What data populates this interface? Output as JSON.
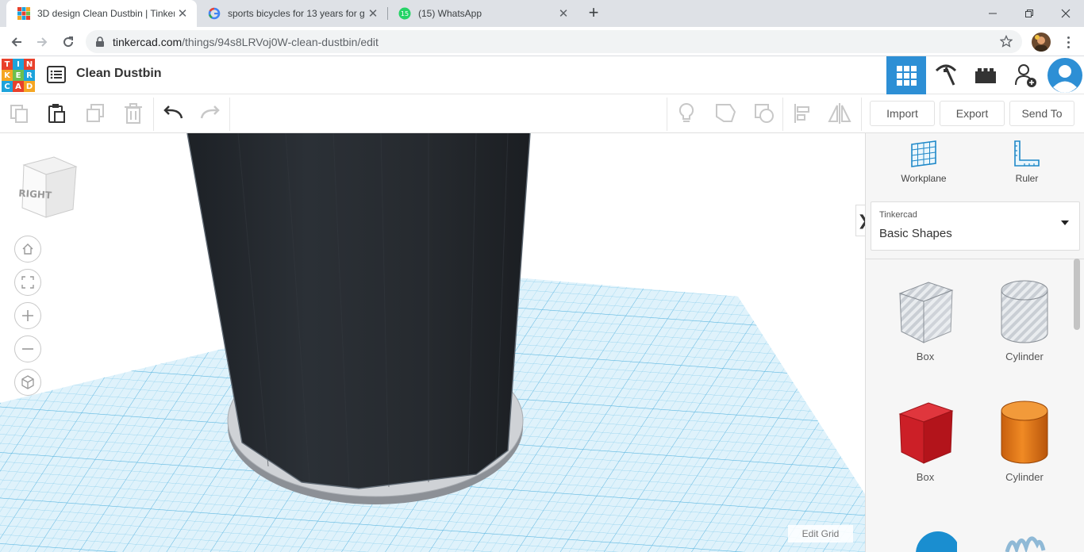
{
  "browser": {
    "tabs": [
      {
        "title": "3D design Clean Dustbin | Tinker",
        "icon": "tinkercad-favicon",
        "active": true
      },
      {
        "title": "sports bicycles for 13 years for gi",
        "icon": "google-favicon",
        "active": false
      },
      {
        "title": "(15) WhatsApp",
        "icon": "whatsapp-favicon",
        "active": false
      }
    ],
    "whatsapp_badge": "15",
    "url_host": "tinkercad.com",
    "url_path": "/things/94s8LRVoj0W-clean-dustbin/edit"
  },
  "header": {
    "logo_letters": [
      "T",
      "I",
      "N",
      "K",
      "E",
      "R",
      "C",
      "A",
      "D"
    ],
    "design_title": "Clean Dustbin"
  },
  "toolbar": {
    "import_label": "Import",
    "export_label": "Export",
    "send_to_label": "Send To"
  },
  "viewport": {
    "viewcube_label": "RIGHT",
    "edit_grid_label": "Edit Grid",
    "panel_toggle": "❯"
  },
  "panel": {
    "workplane_label": "Workplane",
    "ruler_label": "Ruler",
    "library_source": "Tinkercad",
    "library_name": "Basic Shapes",
    "shapes": [
      {
        "label": "Box",
        "style": "hole-box"
      },
      {
        "label": "Cylinder",
        "style": "hole-cylinder"
      },
      {
        "label": "Box",
        "style": "red-box"
      },
      {
        "label": "Cylinder",
        "style": "orange-cylinder"
      }
    ]
  },
  "colors": {
    "accent": "#2d8fd5",
    "grid": "#8fd3ef",
    "dustbin": "#23272c",
    "red_box": "#d1202b",
    "orange_cylinder": "#e27a1b"
  }
}
